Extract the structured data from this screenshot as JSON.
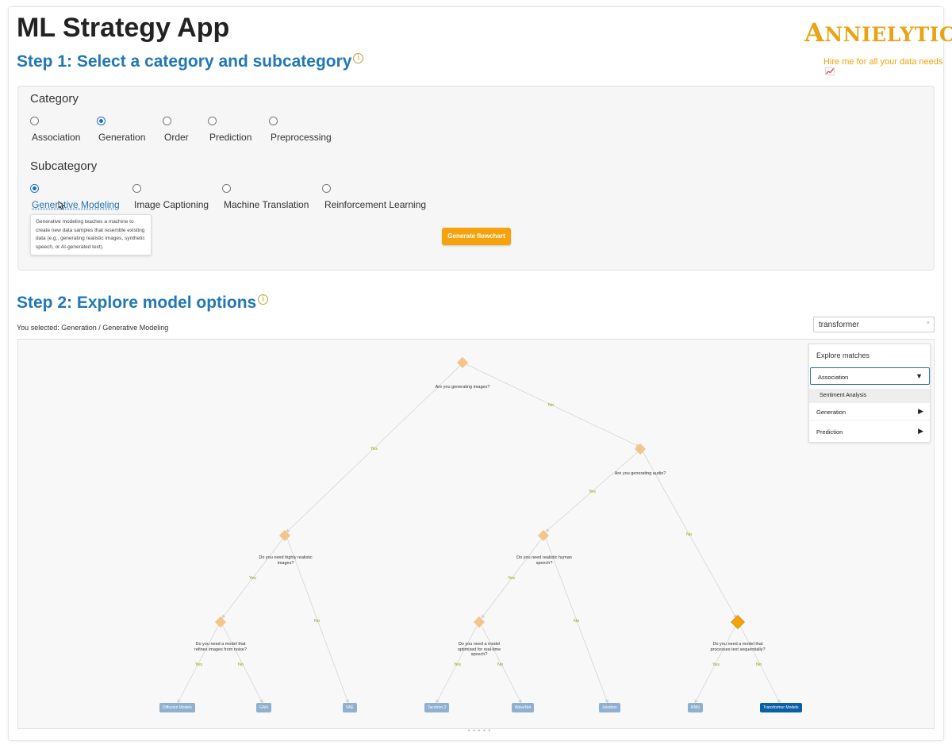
{
  "app": {
    "title": "ML Strategy App",
    "logo_first": "A",
    "logo_rest": "NNIELYTICS",
    "hire_link": "Hire me for all your data needs"
  },
  "step1": {
    "heading": "Step 1: Select a category and subcategory",
    "info": "i",
    "category_label": "Category",
    "categories": [
      "Association",
      "Generation",
      "Order",
      "Prediction",
      "Preprocessing"
    ],
    "category_selected": "Generation",
    "subcategory_label": "Subcategory",
    "subcategories": [
      "Generative Modeling",
      "Image Captioning",
      "Machine Translation",
      "Reinforcement Learning"
    ],
    "subcategory_selected": "Generative Modeling",
    "tooltip": "Generative modeling teaches a machine to create new data samples that resemble existing data (e.g., generating realistic images, synthetic speech, or AI-generated text).",
    "generate_button": "Generate flowchart"
  },
  "step2": {
    "heading": "Step 2: Explore model options",
    "info": "i",
    "selected_text": "You selected: Generation / Generative Modeling",
    "search": {
      "value": "transformer",
      "clear": "×"
    },
    "flowchart": {
      "questions": {
        "q1": "Are you generating images?",
        "q2": "Are you generating audio?",
        "q3": "Do you need highly realistic images?",
        "q4": "Do you need realistic human speech?",
        "q5": "Do you need a model that refines images from noise?",
        "q6": "Do you need a model optimized for real-time speech?",
        "q7": "Do you need a model that processes text sequentially?"
      },
      "yes": "Yes",
      "no": "No",
      "leaves": [
        "Diffusion Models",
        "GAN",
        "VAE",
        "Tacotron 2",
        "WaveNet",
        "Jukebox",
        "RNN",
        "Transformer Models"
      ],
      "highlighted_leaf": "Transformer Models"
    },
    "matches": {
      "title": "Explore matches",
      "groups": [
        {
          "label": "Association",
          "expanded": true,
          "children": [
            "Sentiment Analysis"
          ]
        },
        {
          "label": "Generation",
          "expanded": false
        },
        {
          "label": "Prediction",
          "expanded": false
        }
      ],
      "expanded_arrow": "▼",
      "collapsed_arrow": "▶"
    },
    "resize_handle": "• • • • •"
  }
}
